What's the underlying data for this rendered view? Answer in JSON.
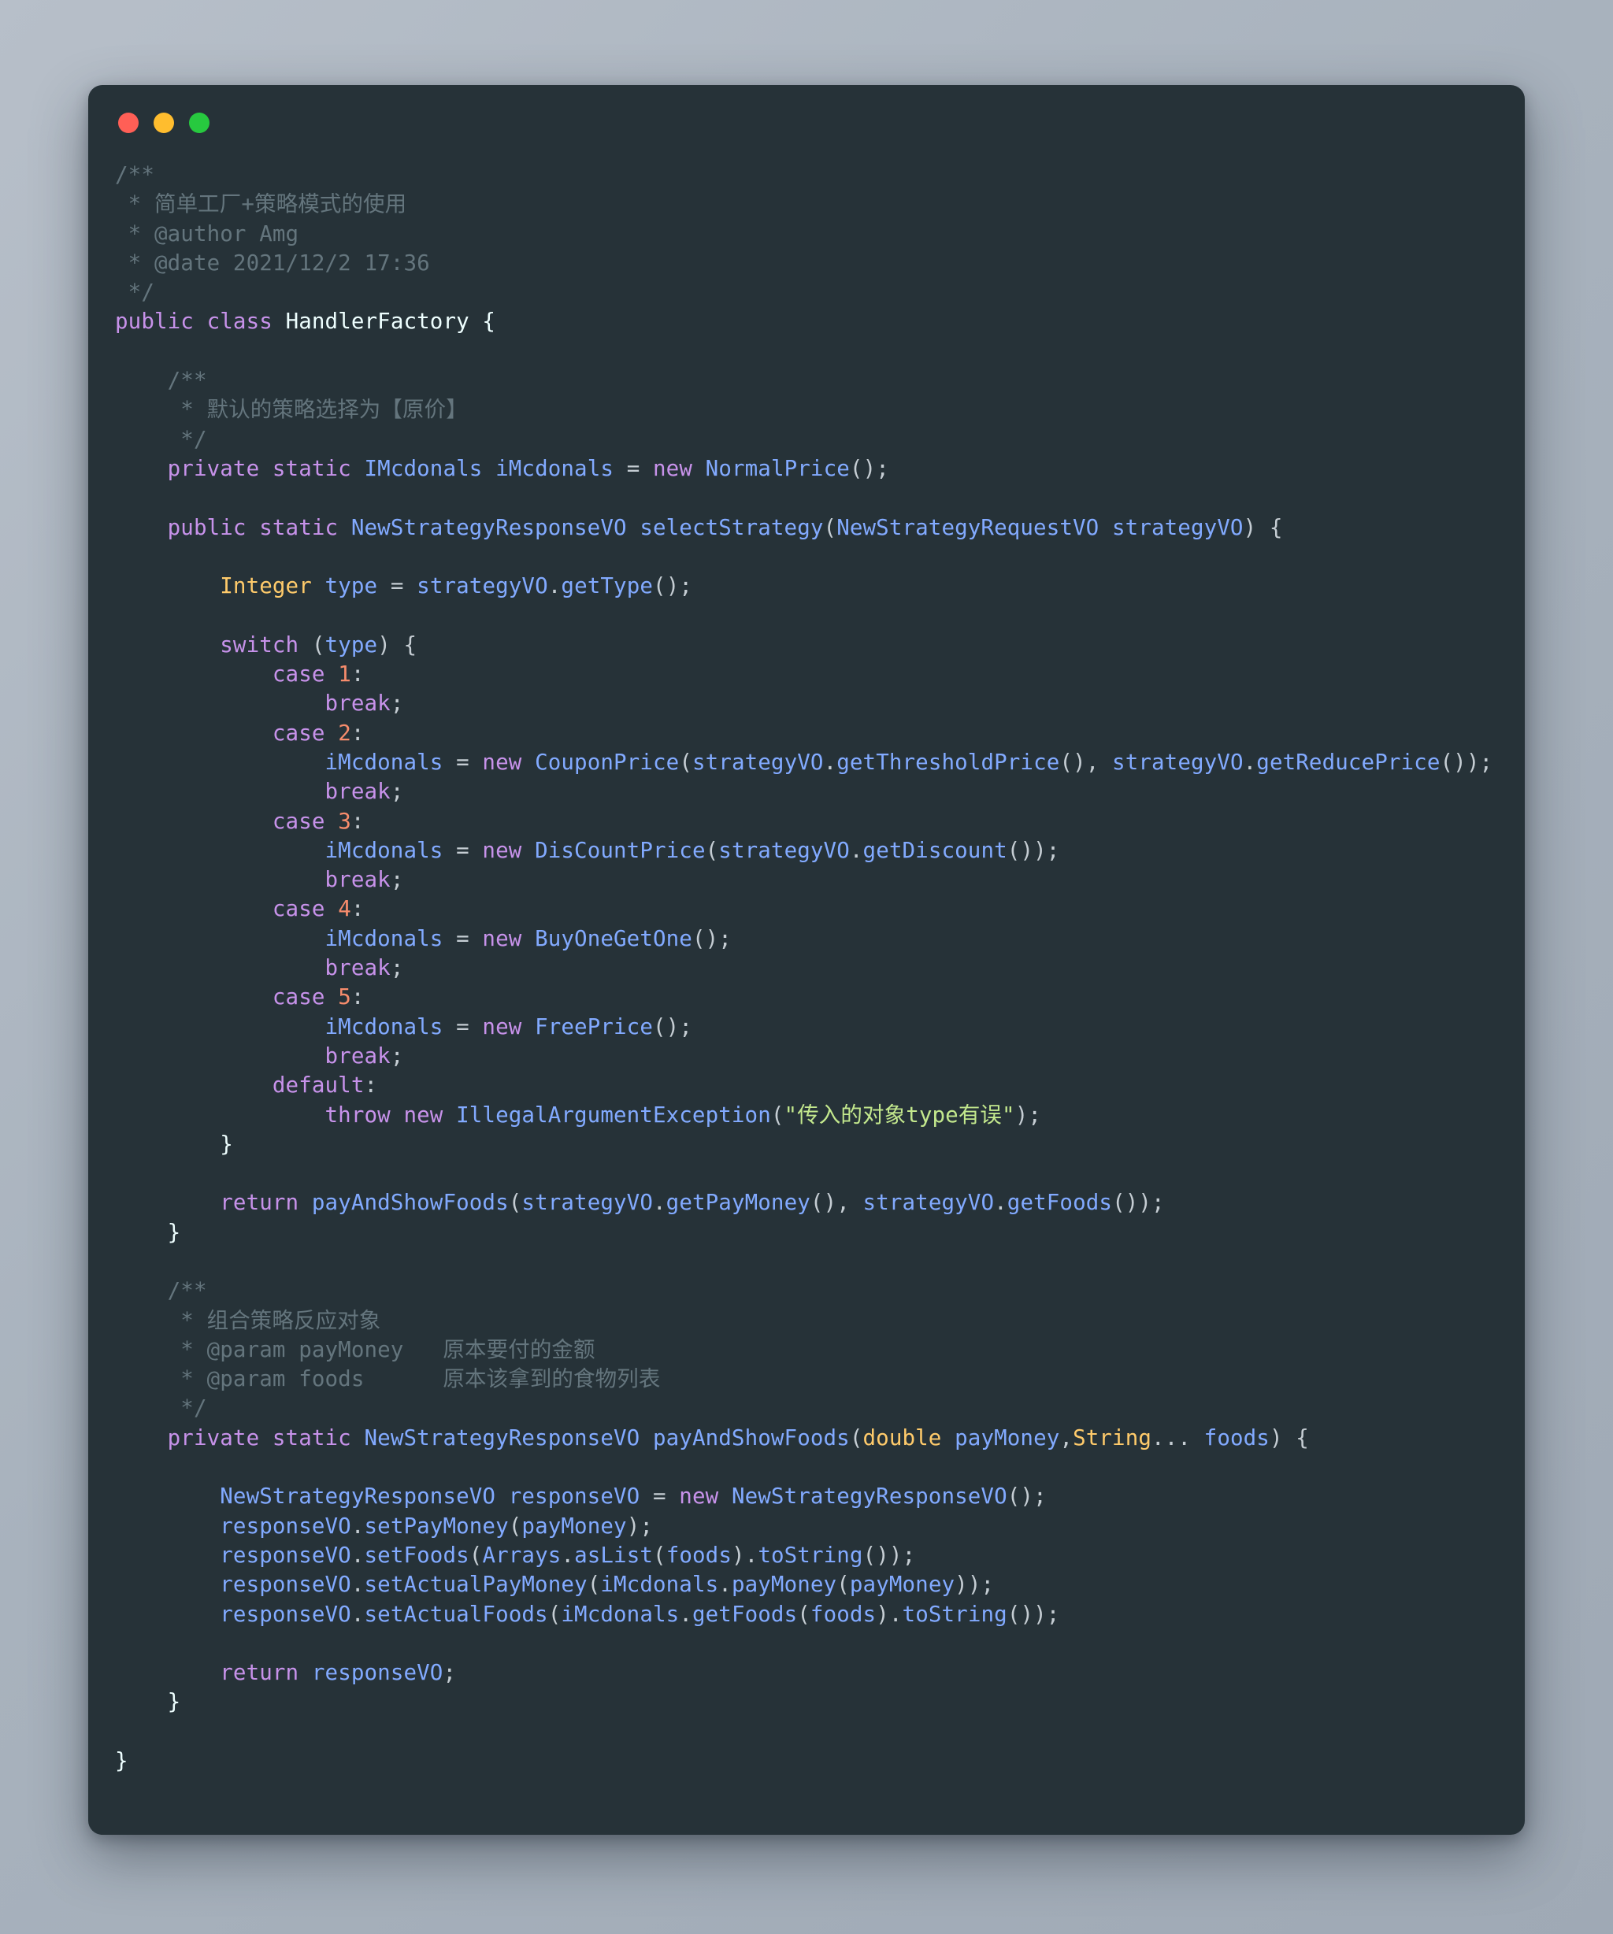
{
  "window": {
    "traffic_lights": [
      {
        "name": "close",
        "color": "#ff5f56"
      },
      {
        "name": "minimize",
        "color": "#ffbd2e"
      },
      {
        "name": "maximize",
        "color": "#27c93f"
      }
    ],
    "background": "#263238",
    "language": "java"
  },
  "theme": {
    "background": "#263238",
    "foreground": "#c5cdd3",
    "comment": "#64757d",
    "keyword": "#c792ea",
    "class": "#82aaff",
    "function": "#82aaff",
    "variable": "#82aaff",
    "type": "#ffcb6b",
    "number": "#f78c6c",
    "string": "#c3e88d",
    "plain": "#eeffff"
  },
  "code": {
    "class_name": "HandlerFactory",
    "author": "Amg",
    "date": "2021/12/2 17:36",
    "header_comment": "简单工厂+策略模式的使用",
    "lines": [
      [
        {
          "t": "/**",
          "c": "cmt"
        }
      ],
      [
        {
          "t": " * 简单工厂+策略模式的使用",
          "c": "cmt"
        }
      ],
      [
        {
          "t": " * @author Amg",
          "c": "cmt"
        }
      ],
      [
        {
          "t": " * @date 2021/12/2 17:36",
          "c": "cmt"
        }
      ],
      [
        {
          "t": " */",
          "c": "cmt"
        }
      ],
      [
        {
          "t": "public class",
          "c": "kw"
        },
        {
          "t": " ",
          "c": "pun"
        },
        {
          "t": "HandlerFactory",
          "c": "plain"
        },
        {
          "t": " {",
          "c": "plain"
        }
      ],
      [
        {
          "t": "",
          "c": "pun"
        }
      ],
      [
        {
          "t": "    /**",
          "c": "cmt"
        }
      ],
      [
        {
          "t": "     * 默认的策略选择为【原价】",
          "c": "cmt"
        }
      ],
      [
        {
          "t": "     */",
          "c": "cmt"
        }
      ],
      [
        {
          "t": "    ",
          "c": "pun"
        },
        {
          "t": "private static",
          "c": "kw"
        },
        {
          "t": " ",
          "c": "pun"
        },
        {
          "t": "IMcdonals",
          "c": "cls"
        },
        {
          "t": " ",
          "c": "pun"
        },
        {
          "t": "iMcdonals",
          "c": "var"
        },
        {
          "t": " = ",
          "c": "op"
        },
        {
          "t": "new",
          "c": "kw"
        },
        {
          "t": " ",
          "c": "pun"
        },
        {
          "t": "NormalPrice",
          "c": "cls"
        },
        {
          "t": "();",
          "c": "pun"
        }
      ],
      [
        {
          "t": "",
          "c": "pun"
        }
      ],
      [
        {
          "t": "    ",
          "c": "pun"
        },
        {
          "t": "public static",
          "c": "kw"
        },
        {
          "t": " ",
          "c": "pun"
        },
        {
          "t": "NewStrategyResponseVO",
          "c": "cls"
        },
        {
          "t": " ",
          "c": "pun"
        },
        {
          "t": "selectStrategy",
          "c": "fn"
        },
        {
          "t": "(",
          "c": "pun"
        },
        {
          "t": "NewStrategyRequestVO",
          "c": "cls"
        },
        {
          "t": " ",
          "c": "pun"
        },
        {
          "t": "strategyVO",
          "c": "var"
        },
        {
          "t": ") {",
          "c": "pun"
        }
      ],
      [
        {
          "t": "",
          "c": "pun"
        }
      ],
      [
        {
          "t": "        ",
          "c": "pun"
        },
        {
          "t": "Integer",
          "c": "typ"
        },
        {
          "t": " ",
          "c": "pun"
        },
        {
          "t": "type",
          "c": "var"
        },
        {
          "t": " = ",
          "c": "op"
        },
        {
          "t": "strategyVO",
          "c": "var"
        },
        {
          "t": ".",
          "c": "pun"
        },
        {
          "t": "getType",
          "c": "fn"
        },
        {
          "t": "();",
          "c": "pun"
        }
      ],
      [
        {
          "t": "",
          "c": "pun"
        }
      ],
      [
        {
          "t": "        ",
          "c": "pun"
        },
        {
          "t": "switch",
          "c": "kw"
        },
        {
          "t": " (",
          "c": "pun"
        },
        {
          "t": "type",
          "c": "var"
        },
        {
          "t": ") {",
          "c": "pun"
        }
      ],
      [
        {
          "t": "            ",
          "c": "pun"
        },
        {
          "t": "case",
          "c": "kw"
        },
        {
          "t": " ",
          "c": "pun"
        },
        {
          "t": "1",
          "c": "num"
        },
        {
          "t": ":",
          "c": "pun"
        }
      ],
      [
        {
          "t": "                ",
          "c": "pun"
        },
        {
          "t": "break",
          "c": "kw"
        },
        {
          "t": ";",
          "c": "pun"
        }
      ],
      [
        {
          "t": "            ",
          "c": "pun"
        },
        {
          "t": "case",
          "c": "kw"
        },
        {
          "t": " ",
          "c": "pun"
        },
        {
          "t": "2",
          "c": "num"
        },
        {
          "t": ":",
          "c": "pun"
        }
      ],
      [
        {
          "t": "                ",
          "c": "pun"
        },
        {
          "t": "iMcdonals",
          "c": "var"
        },
        {
          "t": " = ",
          "c": "op"
        },
        {
          "t": "new",
          "c": "kw"
        },
        {
          "t": " ",
          "c": "pun"
        },
        {
          "t": "CouponPrice",
          "c": "cls"
        },
        {
          "t": "(",
          "c": "pun"
        },
        {
          "t": "strategyVO",
          "c": "var"
        },
        {
          "t": ".",
          "c": "pun"
        },
        {
          "t": "getThresholdPrice",
          "c": "fn"
        },
        {
          "t": "(), ",
          "c": "pun"
        },
        {
          "t": "strategyVO",
          "c": "var"
        },
        {
          "t": ".",
          "c": "pun"
        },
        {
          "t": "getReducePrice",
          "c": "fn"
        },
        {
          "t": "());",
          "c": "pun"
        }
      ],
      [
        {
          "t": "                ",
          "c": "pun"
        },
        {
          "t": "break",
          "c": "kw"
        },
        {
          "t": ";",
          "c": "pun"
        }
      ],
      [
        {
          "t": "            ",
          "c": "pun"
        },
        {
          "t": "case",
          "c": "kw"
        },
        {
          "t": " ",
          "c": "pun"
        },
        {
          "t": "3",
          "c": "num"
        },
        {
          "t": ":",
          "c": "pun"
        }
      ],
      [
        {
          "t": "                ",
          "c": "pun"
        },
        {
          "t": "iMcdonals",
          "c": "var"
        },
        {
          "t": " = ",
          "c": "op"
        },
        {
          "t": "new",
          "c": "kw"
        },
        {
          "t": " ",
          "c": "pun"
        },
        {
          "t": "DisCountPrice",
          "c": "cls"
        },
        {
          "t": "(",
          "c": "pun"
        },
        {
          "t": "strategyVO",
          "c": "var"
        },
        {
          "t": ".",
          "c": "pun"
        },
        {
          "t": "getDiscount",
          "c": "fn"
        },
        {
          "t": "());",
          "c": "pun"
        }
      ],
      [
        {
          "t": "                ",
          "c": "pun"
        },
        {
          "t": "break",
          "c": "kw"
        },
        {
          "t": ";",
          "c": "pun"
        }
      ],
      [
        {
          "t": "            ",
          "c": "pun"
        },
        {
          "t": "case",
          "c": "kw"
        },
        {
          "t": " ",
          "c": "pun"
        },
        {
          "t": "4",
          "c": "num"
        },
        {
          "t": ":",
          "c": "pun"
        }
      ],
      [
        {
          "t": "                ",
          "c": "pun"
        },
        {
          "t": "iMcdonals",
          "c": "var"
        },
        {
          "t": " = ",
          "c": "op"
        },
        {
          "t": "new",
          "c": "kw"
        },
        {
          "t": " ",
          "c": "pun"
        },
        {
          "t": "BuyOneGetOne",
          "c": "cls"
        },
        {
          "t": "();",
          "c": "pun"
        }
      ],
      [
        {
          "t": "                ",
          "c": "pun"
        },
        {
          "t": "break",
          "c": "kw"
        },
        {
          "t": ";",
          "c": "pun"
        }
      ],
      [
        {
          "t": "            ",
          "c": "pun"
        },
        {
          "t": "case",
          "c": "kw"
        },
        {
          "t": " ",
          "c": "pun"
        },
        {
          "t": "5",
          "c": "num"
        },
        {
          "t": ":",
          "c": "pun"
        }
      ],
      [
        {
          "t": "                ",
          "c": "pun"
        },
        {
          "t": "iMcdonals",
          "c": "var"
        },
        {
          "t": " = ",
          "c": "op"
        },
        {
          "t": "new",
          "c": "kw"
        },
        {
          "t": " ",
          "c": "pun"
        },
        {
          "t": "FreePrice",
          "c": "cls"
        },
        {
          "t": "();",
          "c": "pun"
        }
      ],
      [
        {
          "t": "                ",
          "c": "pun"
        },
        {
          "t": "break",
          "c": "kw"
        },
        {
          "t": ";",
          "c": "pun"
        }
      ],
      [
        {
          "t": "            ",
          "c": "pun"
        },
        {
          "t": "default",
          "c": "kw"
        },
        {
          "t": ":",
          "c": "pun"
        }
      ],
      [
        {
          "t": "                ",
          "c": "pun"
        },
        {
          "t": "throw new",
          "c": "kw"
        },
        {
          "t": " ",
          "c": "pun"
        },
        {
          "t": "IllegalArgumentException",
          "c": "cls"
        },
        {
          "t": "(",
          "c": "pun"
        },
        {
          "t": "\"传入的对象type有误\"",
          "c": "str"
        },
        {
          "t": ");",
          "c": "pun"
        }
      ],
      [
        {
          "t": "        }",
          "c": "plain"
        }
      ],
      [
        {
          "t": "",
          "c": "pun"
        }
      ],
      [
        {
          "t": "        ",
          "c": "pun"
        },
        {
          "t": "return",
          "c": "kw"
        },
        {
          "t": " ",
          "c": "pun"
        },
        {
          "t": "payAndShowFoods",
          "c": "fn"
        },
        {
          "t": "(",
          "c": "pun"
        },
        {
          "t": "strategyVO",
          "c": "var"
        },
        {
          "t": ".",
          "c": "pun"
        },
        {
          "t": "getPayMoney",
          "c": "fn"
        },
        {
          "t": "(), ",
          "c": "pun"
        },
        {
          "t": "strategyVO",
          "c": "var"
        },
        {
          "t": ".",
          "c": "pun"
        },
        {
          "t": "getFoods",
          "c": "fn"
        },
        {
          "t": "());",
          "c": "pun"
        }
      ],
      [
        {
          "t": "    }",
          "c": "plain"
        }
      ],
      [
        {
          "t": "",
          "c": "pun"
        }
      ],
      [
        {
          "t": "    /**",
          "c": "cmt"
        }
      ],
      [
        {
          "t": "     * 组合策略反应对象",
          "c": "cmt"
        }
      ],
      [
        {
          "t": "     * @param payMoney   原本要付的金额",
          "c": "cmt"
        }
      ],
      [
        {
          "t": "     * @param foods      原本该拿到的食物列表",
          "c": "cmt"
        }
      ],
      [
        {
          "t": "     */",
          "c": "cmt"
        }
      ],
      [
        {
          "t": "    ",
          "c": "pun"
        },
        {
          "t": "private static",
          "c": "kw"
        },
        {
          "t": " ",
          "c": "pun"
        },
        {
          "t": "NewStrategyResponseVO",
          "c": "cls"
        },
        {
          "t": " ",
          "c": "pun"
        },
        {
          "t": "payAndShowFoods",
          "c": "fn"
        },
        {
          "t": "(",
          "c": "pun"
        },
        {
          "t": "double",
          "c": "typ"
        },
        {
          "t": " ",
          "c": "pun"
        },
        {
          "t": "payMoney",
          "c": "var"
        },
        {
          "t": ",",
          "c": "pun"
        },
        {
          "t": "String",
          "c": "typ"
        },
        {
          "t": "... ",
          "c": "pun"
        },
        {
          "t": "foods",
          "c": "var"
        },
        {
          "t": ") {",
          "c": "pun"
        }
      ],
      [
        {
          "t": "",
          "c": "pun"
        }
      ],
      [
        {
          "t": "        ",
          "c": "pun"
        },
        {
          "t": "NewStrategyResponseVO",
          "c": "cls"
        },
        {
          "t": " ",
          "c": "pun"
        },
        {
          "t": "responseVO",
          "c": "var"
        },
        {
          "t": " = ",
          "c": "op"
        },
        {
          "t": "new",
          "c": "kw"
        },
        {
          "t": " ",
          "c": "pun"
        },
        {
          "t": "NewStrategyResponseVO",
          "c": "cls"
        },
        {
          "t": "();",
          "c": "pun"
        }
      ],
      [
        {
          "t": "        ",
          "c": "pun"
        },
        {
          "t": "responseVO",
          "c": "var"
        },
        {
          "t": ".",
          "c": "pun"
        },
        {
          "t": "setPayMoney",
          "c": "fn"
        },
        {
          "t": "(",
          "c": "pun"
        },
        {
          "t": "payMoney",
          "c": "var"
        },
        {
          "t": ");",
          "c": "pun"
        }
      ],
      [
        {
          "t": "        ",
          "c": "pun"
        },
        {
          "t": "responseVO",
          "c": "var"
        },
        {
          "t": ".",
          "c": "pun"
        },
        {
          "t": "setFoods",
          "c": "fn"
        },
        {
          "t": "(",
          "c": "pun"
        },
        {
          "t": "Arrays",
          "c": "cls"
        },
        {
          "t": ".",
          "c": "pun"
        },
        {
          "t": "asList",
          "c": "fn"
        },
        {
          "t": "(",
          "c": "pun"
        },
        {
          "t": "foods",
          "c": "var"
        },
        {
          "t": ").",
          "c": "pun"
        },
        {
          "t": "toString",
          "c": "fn"
        },
        {
          "t": "());",
          "c": "pun"
        }
      ],
      [
        {
          "t": "        ",
          "c": "pun"
        },
        {
          "t": "responseVO",
          "c": "var"
        },
        {
          "t": ".",
          "c": "pun"
        },
        {
          "t": "setActualPayMoney",
          "c": "fn"
        },
        {
          "t": "(",
          "c": "pun"
        },
        {
          "t": "iMcdonals",
          "c": "var"
        },
        {
          "t": ".",
          "c": "pun"
        },
        {
          "t": "payMoney",
          "c": "fn"
        },
        {
          "t": "(",
          "c": "pun"
        },
        {
          "t": "payMoney",
          "c": "var"
        },
        {
          "t": "));",
          "c": "pun"
        }
      ],
      [
        {
          "t": "        ",
          "c": "pun"
        },
        {
          "t": "responseVO",
          "c": "var"
        },
        {
          "t": ".",
          "c": "pun"
        },
        {
          "t": "setActualFoods",
          "c": "fn"
        },
        {
          "t": "(",
          "c": "pun"
        },
        {
          "t": "iMcdonals",
          "c": "var"
        },
        {
          "t": ".",
          "c": "pun"
        },
        {
          "t": "getFoods",
          "c": "fn"
        },
        {
          "t": "(",
          "c": "pun"
        },
        {
          "t": "foods",
          "c": "var"
        },
        {
          "t": ").",
          "c": "pun"
        },
        {
          "t": "toString",
          "c": "fn"
        },
        {
          "t": "());",
          "c": "pun"
        }
      ],
      [
        {
          "t": "",
          "c": "pun"
        }
      ],
      [
        {
          "t": "        ",
          "c": "pun"
        },
        {
          "t": "return",
          "c": "kw"
        },
        {
          "t": " ",
          "c": "pun"
        },
        {
          "t": "responseVO",
          "c": "var"
        },
        {
          "t": ";",
          "c": "pun"
        }
      ],
      [
        {
          "t": "    }",
          "c": "plain"
        }
      ],
      [
        {
          "t": "",
          "c": "pun"
        }
      ],
      [
        {
          "t": "}",
          "c": "plain"
        }
      ]
    ]
  }
}
